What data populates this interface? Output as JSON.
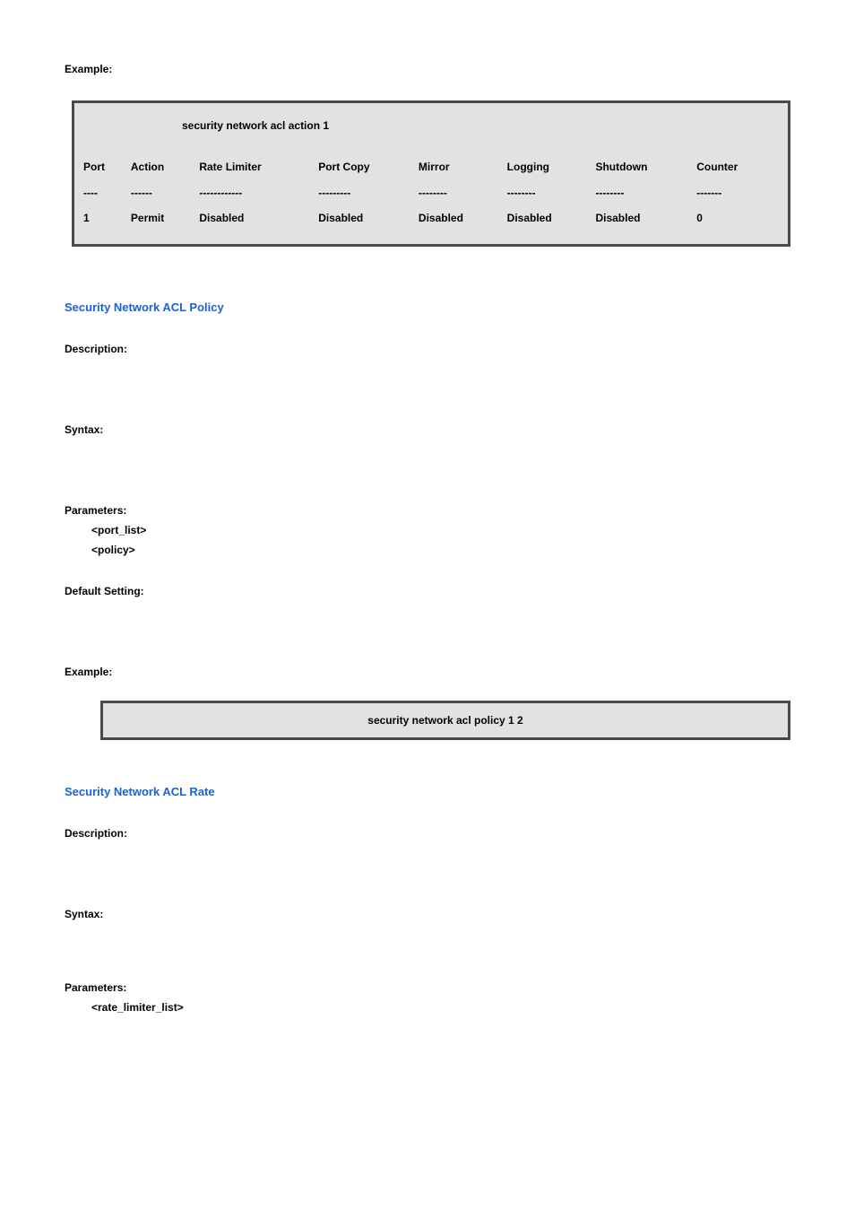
{
  "example1": {
    "label": "Example:",
    "prompt": "security network acl action 1",
    "headers": [
      "Port",
      "Action",
      "Rate Limiter",
      "Port Copy",
      "Mirror",
      "Logging",
      "Shutdown",
      "Counter"
    ],
    "dashes": [
      "----",
      "------",
      "------------",
      "---------",
      "--------",
      "--------",
      "--------",
      "-------"
    ],
    "row": [
      "1",
      "Permit",
      "Disabled",
      "Disabled",
      "Disabled",
      "Disabled",
      "Disabled",
      "0"
    ]
  },
  "policy": {
    "title": "Security Network ACL Policy",
    "description_label": "Description:",
    "syntax_label": "Syntax:",
    "parameters_label": "Parameters:",
    "params": [
      "<port_list>",
      "<policy>"
    ],
    "default_label": "Default Setting:",
    "example_label": "Example:",
    "example_text": "security network acl policy 1 2"
  },
  "rate": {
    "title": "Security Network ACL Rate",
    "description_label": "Description:",
    "syntax_label": "Syntax:",
    "parameters_label": "Parameters:",
    "params": [
      "<rate_limiter_list>"
    ]
  }
}
